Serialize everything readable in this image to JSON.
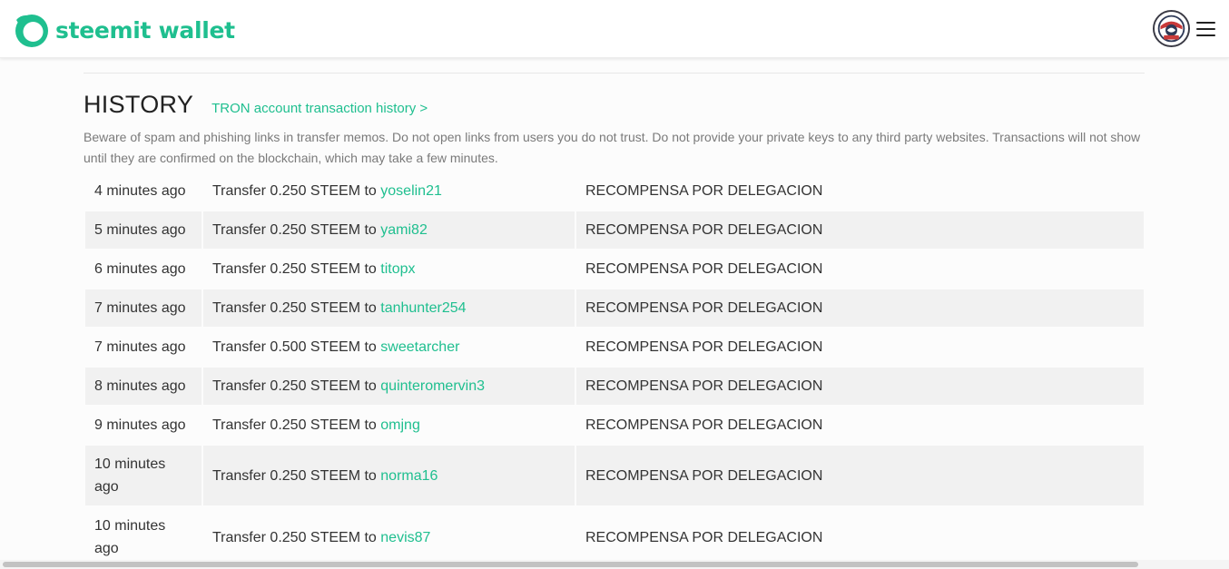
{
  "app": {
    "brand_name": "steemit wallet",
    "brand_color": "#1fbf8f"
  },
  "header": {
    "avatar_icon": "profile-avatar-icon",
    "menu_icon": "hamburger-menu-icon"
  },
  "history": {
    "title": "HISTORY",
    "tron_link": "TRON account transaction history >",
    "warning": "Beware of spam and phishing links in transfer memos. Do not open links from users you do not trust. Do not provide your private keys to any third party websites. Transactions will not show until they are confirmed on the blockchain, which may take a few minutes.",
    "rows": [
      {
        "time": "4 minutes ago",
        "op_prefix": "Transfer 0.250 STEEM to ",
        "recipient": "yoselin21",
        "memo": "RECOMPENSA POR DELEGACION"
      },
      {
        "time": "5 minutes ago",
        "op_prefix": "Transfer 0.250 STEEM to ",
        "recipient": "yami82",
        "memo": "RECOMPENSA POR DELEGACION"
      },
      {
        "time": "6 minutes ago",
        "op_prefix": "Transfer 0.250 STEEM to ",
        "recipient": "titopx",
        "memo": "RECOMPENSA POR DELEGACION"
      },
      {
        "time": "7 minutes ago",
        "op_prefix": "Transfer 0.250 STEEM to ",
        "recipient": "tanhunter254",
        "memo": "RECOMPENSA POR DELEGACION"
      },
      {
        "time": "7 minutes ago",
        "op_prefix": "Transfer 0.500 STEEM to ",
        "recipient": "sweetarcher",
        "memo": "RECOMPENSA POR DELEGACION"
      },
      {
        "time": "8 minutes ago",
        "op_prefix": "Transfer 0.250 STEEM to ",
        "recipient": "quinteromervin3",
        "memo": "RECOMPENSA POR DELEGACION"
      },
      {
        "time": "9 minutes ago",
        "op_prefix": "Transfer 0.250 STEEM to ",
        "recipient": "omjng",
        "memo": "RECOMPENSA POR DELEGACION"
      },
      {
        "time": "10 minutes ago",
        "op_prefix": "Transfer 0.250 STEEM to ",
        "recipient": "norma16",
        "memo": "RECOMPENSA POR DELEGACION"
      },
      {
        "time": "10 minutes ago",
        "op_prefix": "Transfer 0.250 STEEM to ",
        "recipient": "nevis87",
        "memo": "RECOMPENSA POR DELEGACION"
      }
    ]
  }
}
